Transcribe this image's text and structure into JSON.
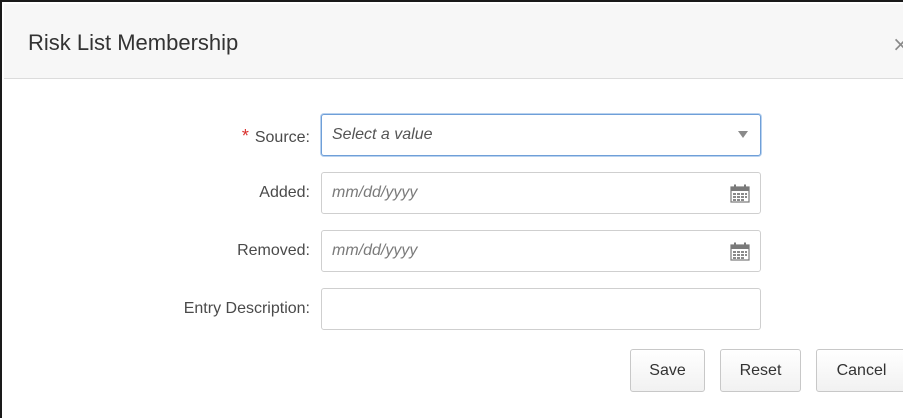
{
  "dialog": {
    "title": "Risk List Membership",
    "close_glyph": "×"
  },
  "form": {
    "source": {
      "label": "Source:",
      "required_marker": "*",
      "placeholder": "Select a value",
      "icon": "chevron-down-icon"
    },
    "added": {
      "label": "Added:",
      "placeholder": "mm/dd/yyyy",
      "icon": "calendar-icon"
    },
    "removed": {
      "label": "Removed:",
      "placeholder": "mm/dd/yyyy",
      "icon": "calendar-icon"
    },
    "entry_description": {
      "label": "Entry Description:",
      "value": ""
    }
  },
  "buttons": {
    "save": "Save",
    "reset": "Reset",
    "cancel": "Cancel"
  },
  "colors": {
    "required": "#d9302c",
    "focus_border": "#6f9fd8",
    "header_bg": "#f7f7f7"
  }
}
